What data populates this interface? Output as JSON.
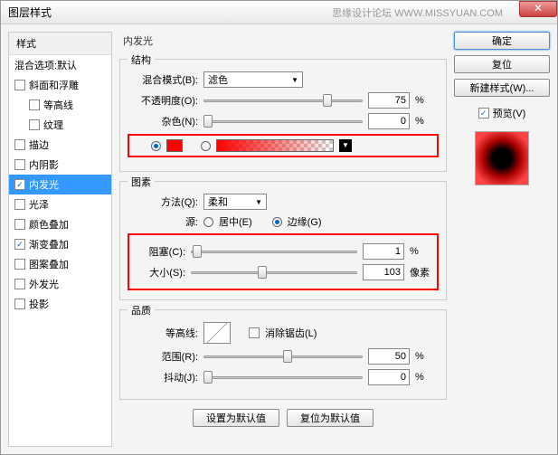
{
  "window": {
    "title": "图层样式",
    "watermark": "思缘设计论坛  WWW.MISSYUAN.COM"
  },
  "sidebar": {
    "header": "样式",
    "blending": "混合选项:默认",
    "items": [
      {
        "label": "斜面和浮雕",
        "checked": false
      },
      {
        "label": "等高线",
        "checked": false,
        "sub": true
      },
      {
        "label": "纹理",
        "checked": false,
        "sub": true
      },
      {
        "label": "描边",
        "checked": false
      },
      {
        "label": "内阴影",
        "checked": false
      },
      {
        "label": "内发光",
        "checked": true,
        "selected": true
      },
      {
        "label": "光泽",
        "checked": false
      },
      {
        "label": "颜色叠加",
        "checked": false
      },
      {
        "label": "渐变叠加",
        "checked": true
      },
      {
        "label": "图案叠加",
        "checked": false
      },
      {
        "label": "外发光",
        "checked": false
      },
      {
        "label": "投影",
        "checked": false
      }
    ]
  },
  "panel": {
    "title": "内发光",
    "structure": {
      "legend": "结构",
      "blendModeLabel": "混合模式(B):",
      "blendMode": "滤色",
      "opacityLabel": "不透明度(O):",
      "opacity": 75,
      "opacityUnit": "%",
      "noiseLabel": "杂色(N):",
      "noise": 0,
      "noiseUnit": "%"
    },
    "elements": {
      "legend": "图素",
      "techniqueLabel": "方法(Q):",
      "technique": "柔和",
      "sourceLabel": "源:",
      "sourceCenter": "居中(E)",
      "sourceEdge": "边缘(G)",
      "chokeLabel": "阻塞(C):",
      "choke": 1,
      "chokeUnit": "%",
      "sizeLabel": "大小(S):",
      "size": 103,
      "sizeUnit": "像素"
    },
    "quality": {
      "legend": "品质",
      "contourLabel": "等高线:",
      "antiAlias": "消除锯齿(L)",
      "rangeLabel": "范围(R):",
      "range": 50,
      "rangeUnit": "%",
      "jitterLabel": "抖动(J):",
      "jitter": 0,
      "jitterUnit": "%"
    },
    "buttons": {
      "makeDefault": "设置为默认值",
      "resetDefault": "复位为默认值"
    }
  },
  "right": {
    "ok": "确定",
    "cancel": "复位",
    "newStyle": "新建样式(W)...",
    "previewLabel": "预览(V)"
  }
}
